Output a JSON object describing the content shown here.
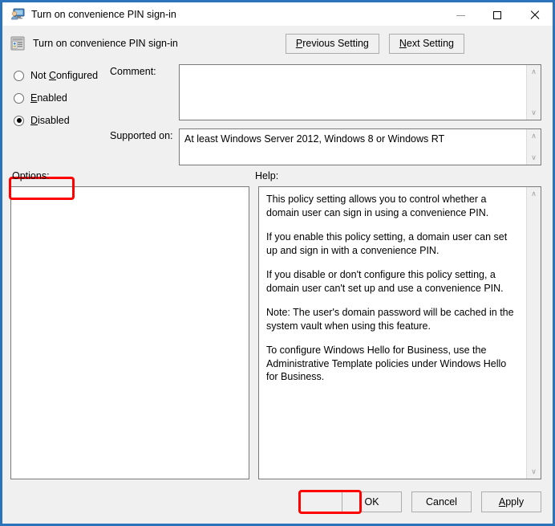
{
  "window": {
    "title": "Turn on convenience PIN sign-in",
    "title_icon": "policy-computer-user-icon",
    "controls": {
      "minimize": "minimize-icon",
      "maximize": "maximize-icon",
      "close": "close-icon"
    }
  },
  "header": {
    "icon": "group-policy-setting-icon",
    "title": "Turn on convenience PIN sign-in",
    "previous_label": "Previous Setting",
    "previous_accel": "P",
    "next_label": "Next Setting",
    "next_accel": "N"
  },
  "state": {
    "options": [
      {
        "label": "Not Configured",
        "accel": "C",
        "selected": false
      },
      {
        "label": "Enabled",
        "accel": "E",
        "selected": false
      },
      {
        "label": "Disabled",
        "accel": "D",
        "selected": true
      }
    ],
    "comment_label": "Comment:",
    "comment_value": "",
    "supported_label": "Supported on:",
    "supported_value": "At least Windows Server 2012, Windows 8 or Windows RT"
  },
  "panels": {
    "options_label": "Options:",
    "options_content": "",
    "help_label": "Help:",
    "help_paragraphs": [
      "This policy setting allows you to control whether a domain user can sign in using a convenience PIN.",
      "If you enable this policy setting, a domain user can set up and sign in with a convenience PIN.",
      "If you disable or don't configure this policy setting, a domain user can't set up and use a convenience PIN.",
      "Note: The user's domain password will be cached in the system vault when using this feature.",
      "To configure Windows Hello for Business, use the Administrative Template policies under Windows Hello for Business."
    ]
  },
  "footer": {
    "ok_label": "OK",
    "cancel_label": "Cancel",
    "apply_label": "Apply",
    "apply_accel": "A"
  },
  "scroll": {
    "up_glyph": "∧",
    "down_glyph": "∨"
  },
  "colors": {
    "window_border": "#2B73BA",
    "dialog_background": "#F0F0F0",
    "highlight": "#FF0000",
    "field_border": "#7A7A7A",
    "button_border": "#ADADAD"
  }
}
